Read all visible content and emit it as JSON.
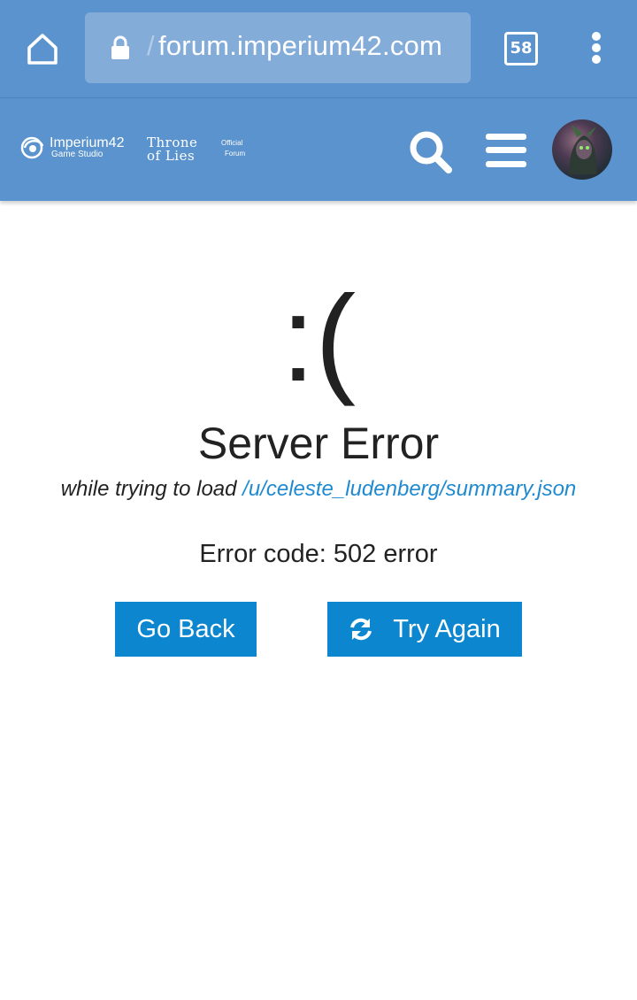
{
  "browser": {
    "url_prefix": "/",
    "url": "forum.imperium42.com",
    "tab_count": "58",
    "icons": [
      "home-icon",
      "lock-icon",
      "tabs-icon",
      "more-vert-icon"
    ]
  },
  "header": {
    "brand_name": "Imperium42",
    "brand_sub": "Game Studio",
    "game_line1": "Throne",
    "game_line2": "of Lies",
    "official_label": "Official",
    "forum_label": "Forum",
    "icons": [
      "search-icon",
      "menu-icon",
      "avatar"
    ],
    "accent_color": "#5a93cd"
  },
  "error": {
    "face": ":(",
    "title": "Server Error",
    "detail_prefix": "while trying to load ",
    "detail_path": "/u/celeste_ludenberg/summary.json",
    "code_text": "Error code: 502 error"
  },
  "actions": {
    "back_label": "Go Back",
    "retry_label": "Try Again",
    "button_color": "#0b86cf"
  }
}
